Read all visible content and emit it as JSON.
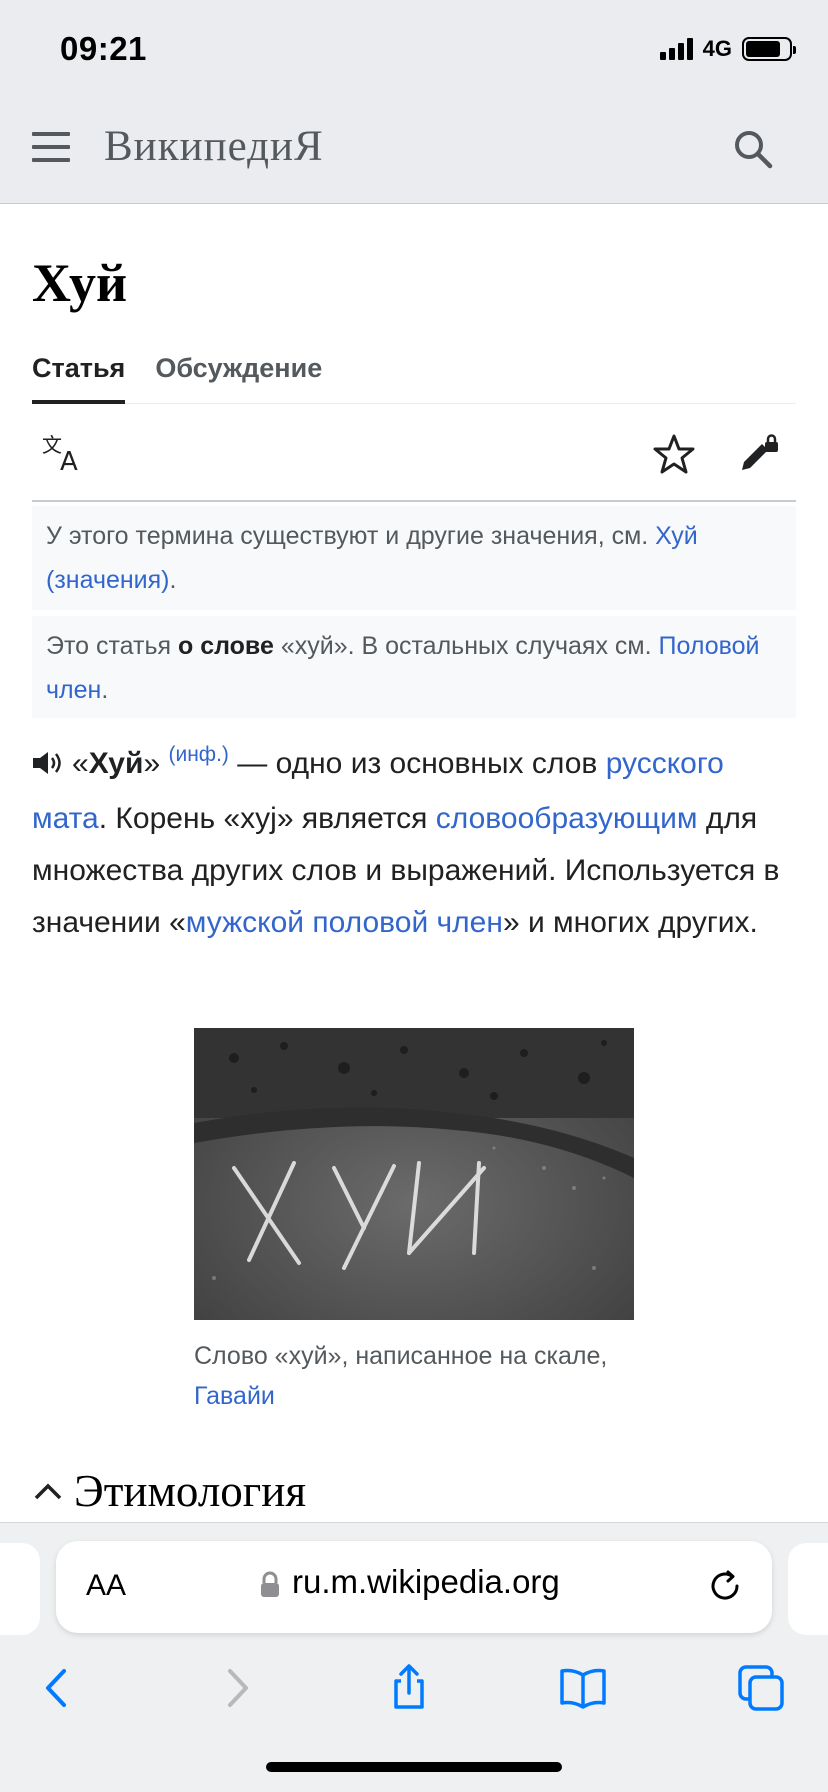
{
  "status_bar": {
    "time": "09:21",
    "network": "4G"
  },
  "header": {
    "logo": "ВикипедиЯ"
  },
  "page": {
    "title": "Хуй",
    "tabs": [
      {
        "label": "Статья",
        "active": true
      },
      {
        "label": "Обсуждение",
        "active": false
      }
    ]
  },
  "hatnotes": {
    "first": {
      "text": "У этого термина существуют и другие значения, см. ",
      "link": "Хуй (значения)",
      "tail": "."
    },
    "second": {
      "pre": "Это статья ",
      "bold": "о слове",
      "mid": " «хуй». В остальных случаях см. ",
      "link": "Половой член",
      "tail": "."
    }
  },
  "intro": {
    "open_quote": "«",
    "term": "Хуй",
    "close_quote": "»",
    "audio_label": "(инф.)",
    "t1": " — одно из основных слов ",
    "link1": "русского мата",
    "t2": ". Корень «xyj» является ",
    "link2": "словообразующим",
    "t3": " для множества других слов и выражений. Используется в значении «",
    "link3": "мужской половой член",
    "t4": "» и многих других."
  },
  "figure": {
    "caption_text": "Слово «хуй», написанное на скале, ",
    "caption_link": "Гавайи"
  },
  "section": {
    "title": "Этимология"
  },
  "browser": {
    "aa_label": "AA",
    "url": "ru.m.wikipedia.org"
  },
  "colors": {
    "link": "#3366cc",
    "header_bg": "#eaecf0",
    "hatnote_bg": "#f8f9fa"
  },
  "icons": [
    "menu-icon",
    "search-icon",
    "language-icon",
    "star-icon",
    "edit-lock-icon",
    "speaker-icon",
    "chevron-up-icon",
    "lock-icon",
    "reload-icon",
    "back-icon",
    "forward-icon",
    "share-icon",
    "bookmarks-icon",
    "tabs-icon"
  ]
}
